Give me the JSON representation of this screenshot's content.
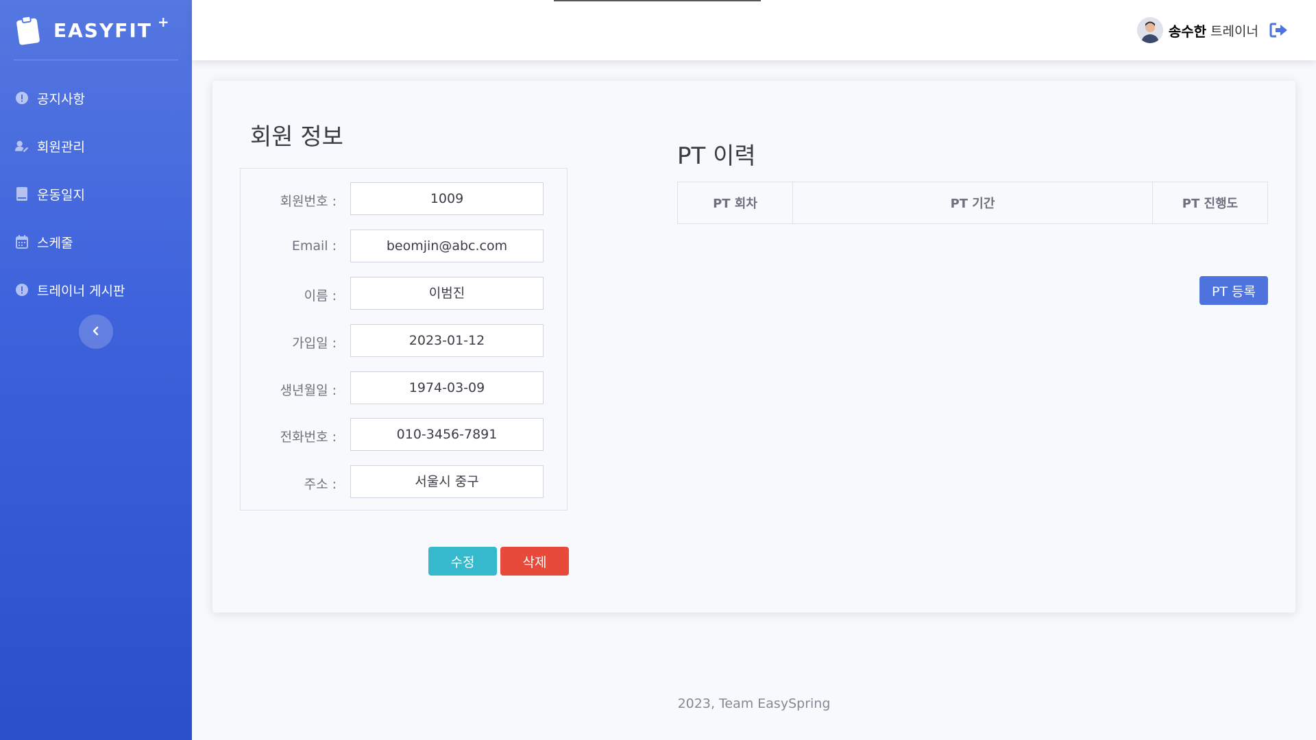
{
  "brand": {
    "name": "EASYFIT",
    "plus": "+"
  },
  "sidebar": {
    "items": [
      {
        "label": "공지사항",
        "icon": "exclamation-circle-icon"
      },
      {
        "label": "회원관리",
        "icon": "user-edit-icon"
      },
      {
        "label": "운동일지",
        "icon": "book-icon"
      },
      {
        "label": "스케줄",
        "icon": "calendar-icon"
      },
      {
        "label": "트레이너 게시판",
        "icon": "exclamation-circle-icon"
      }
    ],
    "collapse_icon": "chevron-left-icon"
  },
  "topbar": {
    "user_name": "송수한",
    "user_role": "트레이너",
    "logout_icon": "sign-out-icon"
  },
  "member_info": {
    "title": "회원 정보",
    "fields": [
      {
        "label": "회원번호 :",
        "value": "1009"
      },
      {
        "label": "Email :",
        "value": "beomjin@abc.com"
      },
      {
        "label": "이름 :",
        "value": "이범진"
      },
      {
        "label": "가입일 :",
        "value": "2023-01-12"
      },
      {
        "label": "생년월일 :",
        "value": "1974-03-09"
      },
      {
        "label": "전화번호 :",
        "value": "010-3456-7891"
      },
      {
        "label": "주소 :",
        "value": "서울시 중구"
      }
    ],
    "edit_label": "수정",
    "delete_label": "삭제"
  },
  "pt_history": {
    "title": "PT 이력",
    "columns": [
      "PT 회차",
      "PT 기간",
      "PT 진행도"
    ],
    "register_label": "PT 등록"
  },
  "footer": {
    "text": "2023, Team EasySpring"
  },
  "colors": {
    "sidebar": "#4e73df",
    "primary": "#4e73df",
    "info": "#36b9cc",
    "danger": "#e74a3b"
  }
}
